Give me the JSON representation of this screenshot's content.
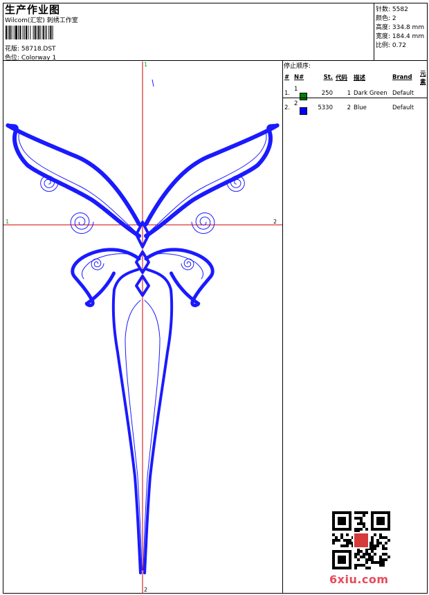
{
  "header": {
    "title": "生产作业图",
    "subtitle": "Wilcom(汇宏) 刺绣工作室",
    "design_label": "花版",
    "design_value": "58718.DST",
    "colorway_label": "色位",
    "colorway_value": "Colorway 1"
  },
  "stats": [
    {
      "label": "针数",
      "value": "5582"
    },
    {
      "label": "颜色",
      "value": "2"
    },
    {
      "label": "高度",
      "value": "334.8 mm"
    },
    {
      "label": "宽度",
      "value": "184.4 mm"
    },
    {
      "label": "比例",
      "value": "0.72"
    }
  ],
  "stop_sequence": {
    "title": "停止顺序:",
    "columns": [
      "#",
      "N#",
      "St.",
      "代码",
      "描述",
      "Brand",
      "元素"
    ],
    "rows": [
      {
        "index": "1.",
        "n": "1",
        "color": "#008000",
        "stitches": "250",
        "code": "1",
        "description": "Dark Green",
        "brand": "Default"
      },
      {
        "index": "2.",
        "n": "2",
        "color": "#0000ff",
        "stitches": "5330",
        "code": "2",
        "description": "Blue",
        "brand": "Default"
      }
    ]
  },
  "axes": {
    "top_label": "1",
    "bottom_label": "2",
    "left_label": "1",
    "right_label": "2"
  },
  "colors": {
    "axis": "#cc0000",
    "stitch_blue": "#1a1aff",
    "watermark": "#e84a5a"
  },
  "watermark": "6xiu.com"
}
